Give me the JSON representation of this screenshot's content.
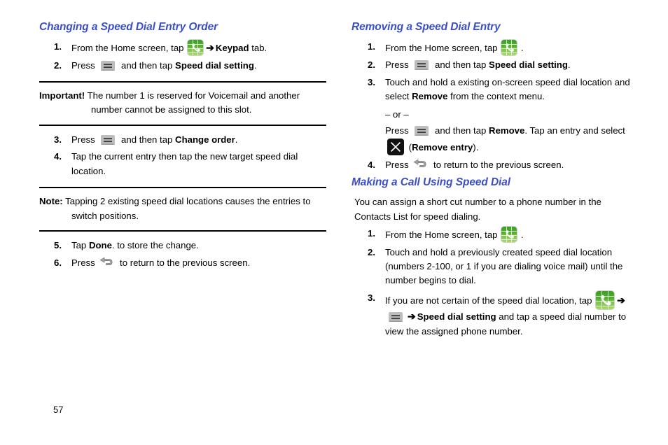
{
  "page": {
    "number": "57"
  },
  "icons": {
    "phone": "phone-dialer-icon",
    "menu": "menu-key-icon",
    "back": "back-key-icon",
    "remove": "remove-x-icon",
    "arrow": "➔"
  },
  "left_column": {
    "heading": "Changing a Speed Dial Entry Order",
    "steps_first": [
      {
        "num": "1.",
        "parts": [
          {
            "type": "text",
            "text": "From the Home screen, tap "
          },
          {
            "type": "icon",
            "icon": "phone"
          },
          {
            "type": "arrow"
          },
          {
            "type": "bold",
            "text": "Keypad"
          },
          {
            "type": "text",
            "text": " tab."
          }
        ]
      },
      {
        "num": "2.",
        "parts": [
          {
            "type": "text",
            "text": "Press "
          },
          {
            "type": "icon",
            "icon": "menu"
          },
          {
            "type": "text",
            "text": " and then tap "
          },
          {
            "type": "bold",
            "text": "Speed dial setting"
          },
          {
            "type": "text",
            "text": "."
          }
        ]
      }
    ],
    "callout_important": {
      "lead": "Important!",
      "text": " The number 1 is reserved for Voicemail and another number cannot be assigned to this slot."
    },
    "steps_second": [
      {
        "num": "3.",
        "parts": [
          {
            "type": "text",
            "text": "Press "
          },
          {
            "type": "icon",
            "icon": "menu"
          },
          {
            "type": "text",
            "text": " and then tap "
          },
          {
            "type": "bold",
            "text": "Change order"
          },
          {
            "type": "text",
            "text": "."
          }
        ]
      },
      {
        "num": "4.",
        "parts": [
          {
            "type": "text",
            "text": "Tap the current entry then tap the new target speed dial location."
          }
        ]
      }
    ],
    "callout_note": {
      "lead": "Note:",
      "text": " Tapping 2 existing speed dial locations causes the entries to switch positions."
    },
    "steps_third": [
      {
        "num": "5.",
        "parts": [
          {
            "type": "text",
            "text": "Tap "
          },
          {
            "type": "bold",
            "text": "Done"
          },
          {
            "type": "text",
            "text": ". to store the change."
          }
        ]
      },
      {
        "num": "6.",
        "parts": [
          {
            "type": "text",
            "text": "Press "
          },
          {
            "type": "icon",
            "icon": "back"
          },
          {
            "type": "text",
            "text": " to return to the previous screen."
          }
        ]
      }
    ]
  },
  "right_column": {
    "heading_removing": "Removing a Speed Dial Entry",
    "steps_removing": [
      {
        "num": "1.",
        "parts": [
          {
            "type": "text",
            "text": "From the Home screen, tap "
          },
          {
            "type": "icon",
            "icon": "phone"
          },
          {
            "type": "text",
            "text": " ."
          }
        ]
      },
      {
        "num": "2.",
        "parts": [
          {
            "type": "text",
            "text": "Press "
          },
          {
            "type": "icon",
            "icon": "menu"
          },
          {
            "type": "text",
            "text": " and then tap "
          },
          {
            "type": "bold",
            "text": "Speed dial setting"
          },
          {
            "type": "text",
            "text": "."
          }
        ]
      },
      {
        "num": "3.",
        "parts": [
          {
            "type": "text",
            "text": "Touch and hold a existing on-screen speed dial location and select "
          },
          {
            "type": "bold",
            "text": "Remove"
          },
          {
            "type": "text",
            "text": " from the context menu."
          }
        ],
        "or_label": "– or –",
        "alt_parts": [
          {
            "type": "text",
            "text": "Press "
          },
          {
            "type": "icon",
            "icon": "menu"
          },
          {
            "type": "text",
            "text": " and then tap "
          },
          {
            "type": "bold",
            "text": "Remove"
          },
          {
            "type": "text",
            "text": ". Tap an entry and select "
          },
          {
            "type": "icon",
            "icon": "remove"
          },
          {
            "type": "text",
            "text": " ("
          },
          {
            "type": "bold",
            "text": "Remove entry"
          },
          {
            "type": "text",
            "text": ")."
          }
        ]
      },
      {
        "num": "4.",
        "parts": [
          {
            "type": "text",
            "text": "Press "
          },
          {
            "type": "icon",
            "icon": "back"
          },
          {
            "type": "text",
            "text": " to return to the previous screen."
          }
        ]
      }
    ],
    "heading_making": "Making a Call Using Speed Dial",
    "intro": "You can assign a short cut number to a phone number in the Contacts List for speed dialing.",
    "steps_making": [
      {
        "num": "1.",
        "parts": [
          {
            "type": "text",
            "text": "From the Home screen, tap "
          },
          {
            "type": "icon",
            "icon": "phone"
          },
          {
            "type": "text",
            "text": " ."
          }
        ]
      },
      {
        "num": "2.",
        "parts": [
          {
            "type": "text",
            "text": "Touch and hold a previously created speed dial location (numbers 2-100, or 1 if you are dialing voice mail) until the number begins to dial."
          }
        ]
      },
      {
        "num": "3.",
        "parts": [
          {
            "type": "text",
            "text": "If you are not certain of the speed dial location, tap "
          },
          {
            "type": "icon",
            "icon": "phone-lg"
          },
          {
            "type": "arrow"
          },
          {
            "type": "icon",
            "icon": "menu"
          },
          {
            "type": "arrow"
          },
          {
            "type": "bold",
            "text": "Speed dial setting"
          },
          {
            "type": "text",
            "text": " and tap a speed dial number to view the assigned phone number."
          }
        ]
      }
    ]
  }
}
